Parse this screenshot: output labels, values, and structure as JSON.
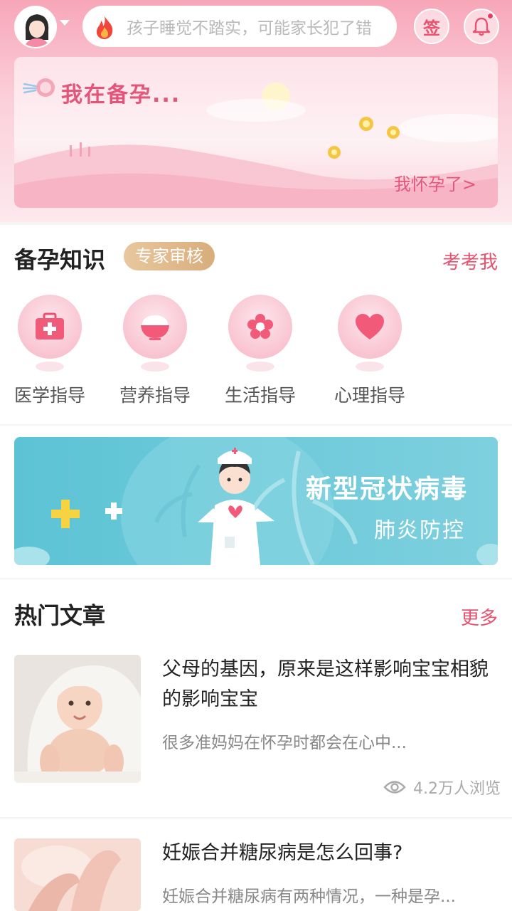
{
  "header": {
    "search_placeholder": "孩子睡觉不踏实，可能家长犯了错",
    "sign_label": "签"
  },
  "banner": {
    "status_text": "我在备孕...",
    "switch_link": "我怀孕了>"
  },
  "knowledge": {
    "title": "备孕知识",
    "badge": "专家审核",
    "quiz_link": "考考我",
    "guides": [
      {
        "label": "医学指导",
        "icon": "medical-kit-icon"
      },
      {
        "label": "营养指导",
        "icon": "rice-bowl-icon"
      },
      {
        "label": "生活指导",
        "icon": "flower-icon"
      },
      {
        "label": "心理指导",
        "icon": "heart-icon"
      }
    ]
  },
  "covid_banner": {
    "line1": "新型冠状病毒",
    "line2": "肺炎防控"
  },
  "articles": {
    "title": "热门文章",
    "more_link": "更多",
    "items": [
      {
        "title": "父母的基因，原来是这样影响宝宝相貌的影响宝宝",
        "summary": "很多准妈妈在怀孕时都会在心中...",
        "views": "4.2万人浏览"
      },
      {
        "title": "妊娠合并糖尿病是怎么回事?",
        "summary": "妊娠合并糖尿病有两种情况，一种是孕..."
      }
    ]
  },
  "colors": {
    "accent": "#e8516f",
    "header_pink": "#f7a6b8",
    "badge_gold": "#d9ad7b",
    "covid_teal": "#5cc3d5"
  }
}
